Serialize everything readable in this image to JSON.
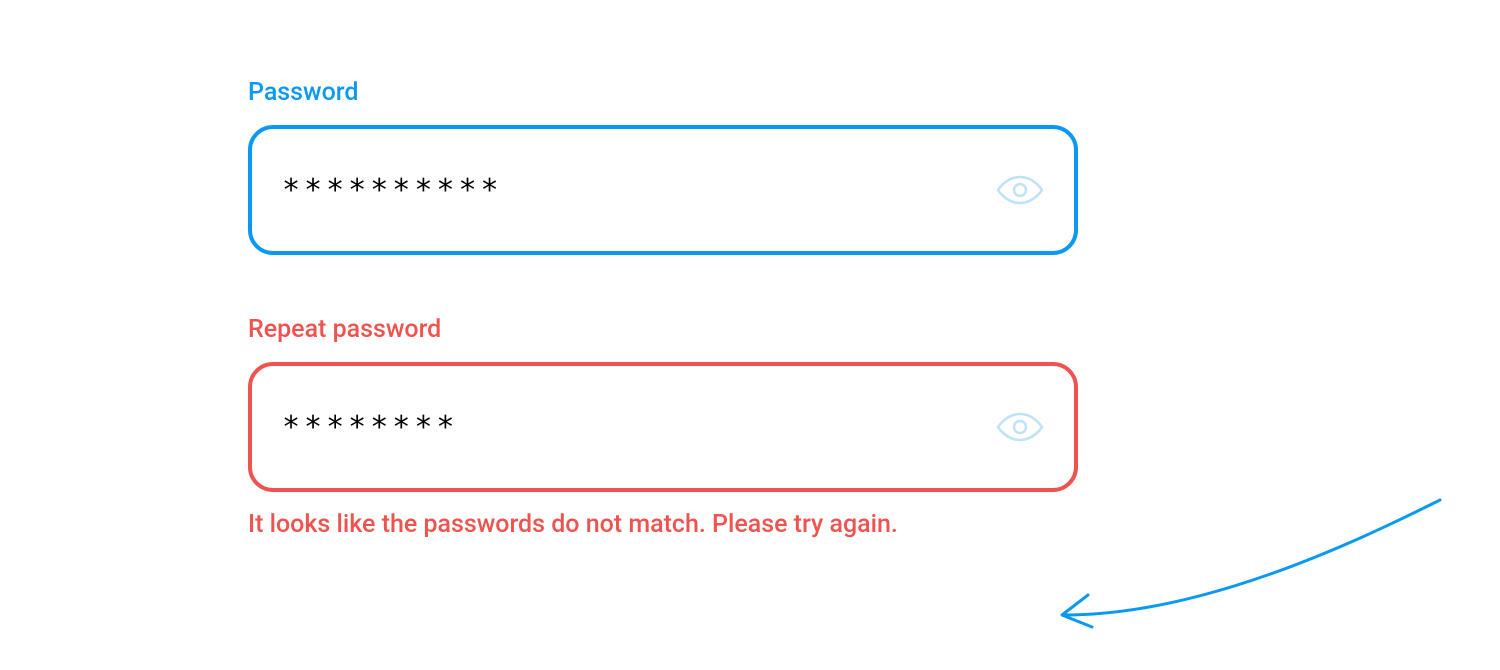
{
  "colors": {
    "primary": "#0A99F2",
    "error": "#EF5350",
    "eye_icon": "#BFE3F5"
  },
  "password_field": {
    "label": "Password",
    "value": "**********"
  },
  "repeat_password_field": {
    "label": "Repeat password",
    "value": "********",
    "error_message": "It looks like the passwords do not match. Please try again."
  }
}
